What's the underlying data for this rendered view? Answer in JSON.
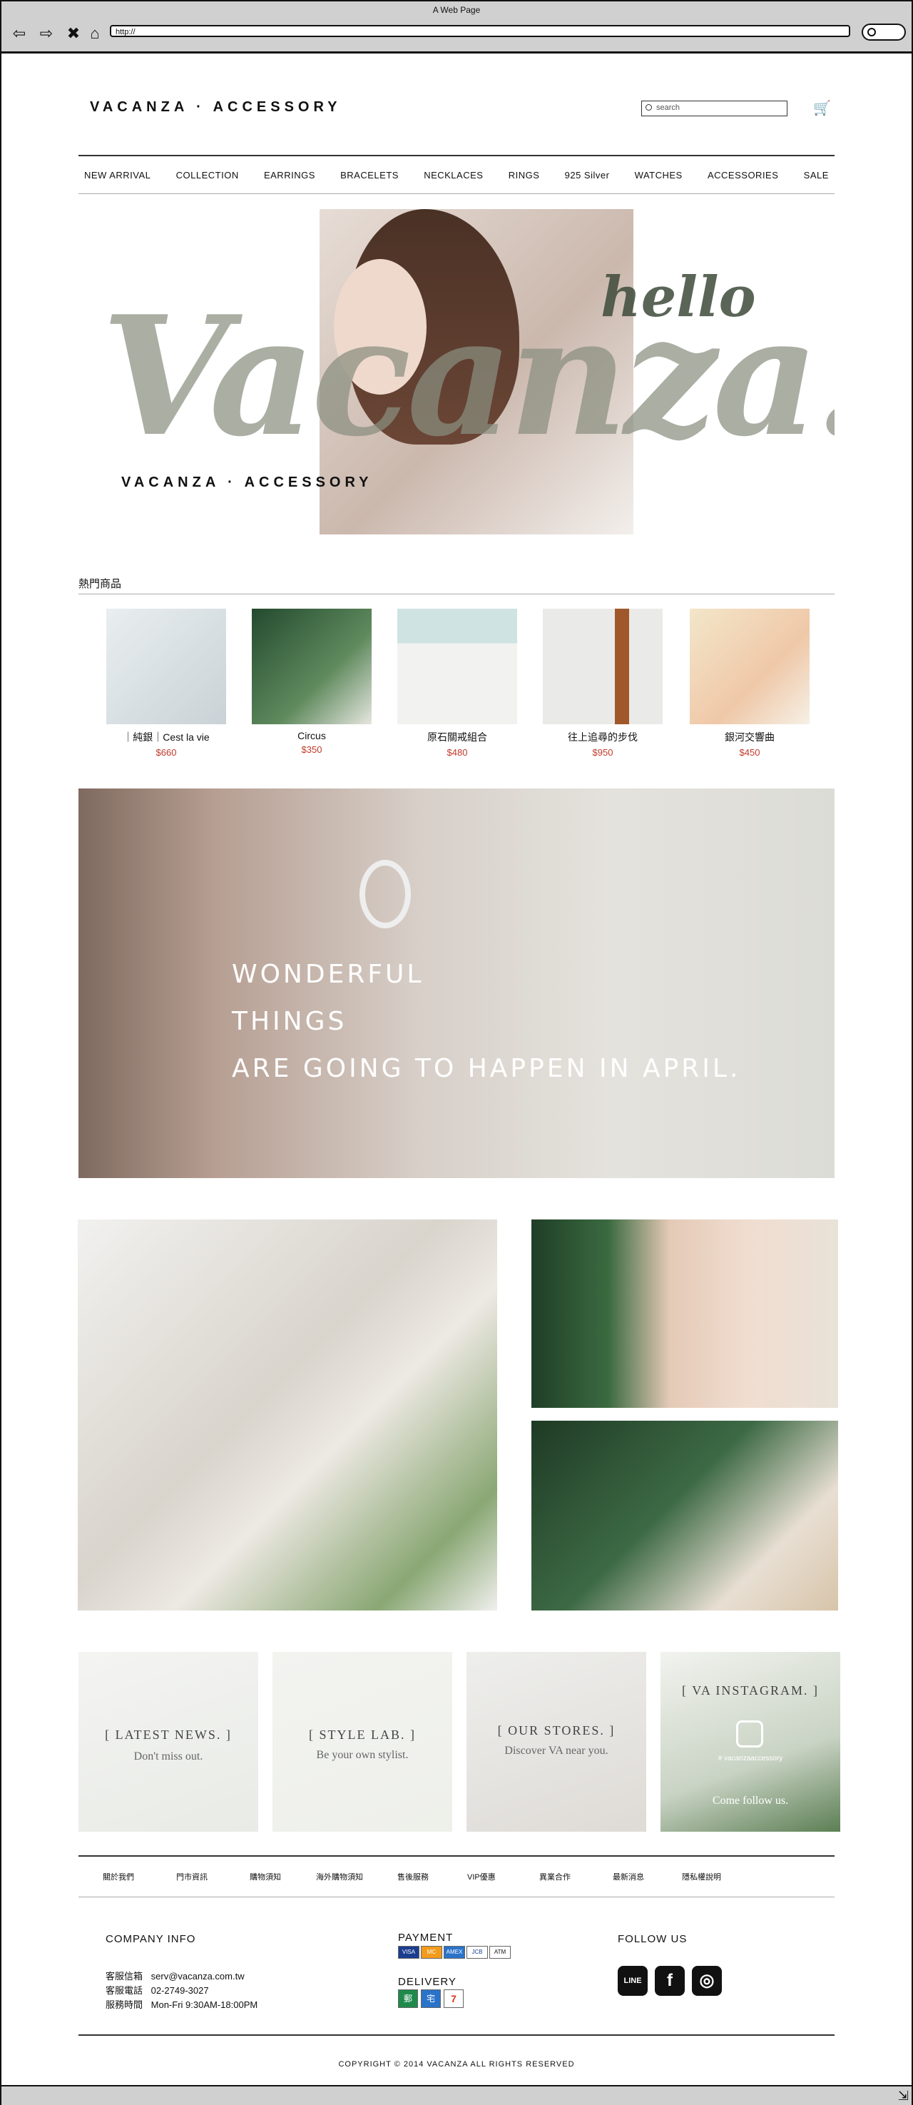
{
  "browser": {
    "title": "A Web Page",
    "url": "http://"
  },
  "header": {
    "logo": "VACANZA · ACCESSORY",
    "search_placeholder": "search"
  },
  "nav": [
    "NEW ARRIVAL",
    "COLLECTION",
    "EARRINGS",
    "BRACELETS",
    "NECKLACES",
    "RINGS",
    "925 Silver",
    "WATCHES",
    "ACCESSORIES",
    "SALE"
  ],
  "hero": {
    "big_text": "Vacanza!",
    "hello": "hello",
    "subtitle": "VACANZA · ACCESSORY"
  },
  "hot": {
    "title": "熱門商品",
    "products": [
      {
        "name": "｜純銀｜Cest la vie",
        "price": "$660"
      },
      {
        "name": "Circus",
        "price": "$350"
      },
      {
        "name": "原石關戒組合",
        "price": "$480"
      },
      {
        "name": "往上追尋的步伐",
        "price": "$950"
      },
      {
        "name": "銀河交響曲",
        "price": "$450"
      }
    ]
  },
  "banner": {
    "line1": "WONDERFUL",
    "line2": "THINGS",
    "line3": "ARE GOING TO HAPPEN IN APRIL."
  },
  "cards": [
    {
      "title": "[ LATEST NEWS. ]",
      "sub": "Don't miss out."
    },
    {
      "title": "[ STYLE LAB. ]",
      "sub": "Be your own stylist."
    },
    {
      "title": "[ OUR STORES. ]",
      "sub": "Discover VA near you."
    },
    {
      "title": "[ VA INSTAGRAM. ]",
      "sub": "Come follow us.",
      "handle": "# vacanzaaccessory"
    }
  ],
  "footer_links": [
    "關於我們",
    "門市資訊",
    "購物須知",
    "海外購物須知",
    "售後服務",
    "VIP優惠",
    "異業合作",
    "最新消息",
    "隱私權說明"
  ],
  "company": {
    "heading": "COMPANY INFO",
    "rows": [
      {
        "label": "客服信箱",
        "value": "serv@vacanza.com.tw"
      },
      {
        "label": "客服電話",
        "value": "02-2749-3027"
      },
      {
        "label": "服務時間",
        "value": "Mon-Fri 9:30AM-18:00PM"
      }
    ]
  },
  "payment": {
    "heading": "PAYMENT",
    "icons": [
      "VISA",
      "MC",
      "AMEX",
      "JCB",
      "ATM"
    ]
  },
  "delivery": {
    "heading": "DELIVERY",
    "icons": [
      "郵",
      "宅",
      "7"
    ]
  },
  "follow": {
    "heading": "FOLLOW US",
    "icons": [
      "LINE",
      "f",
      "◎"
    ]
  },
  "copyright": "COPYRIGHT © 2014 VACANZA ALL RIGHTS RESERVED"
}
